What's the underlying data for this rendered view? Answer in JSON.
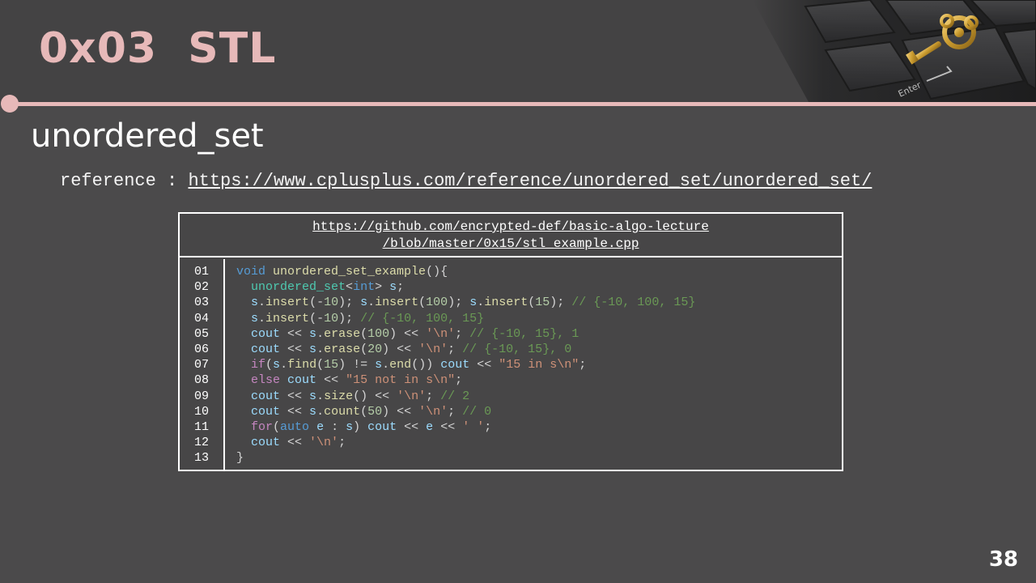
{
  "slide": {
    "title": "0x03  STL",
    "section_heading": "unordered_set",
    "reference_label": "reference : ",
    "reference_url": "https://www.cplusplus.com/reference/unordered_set/unordered_set/",
    "page_number": "38"
  },
  "code_box": {
    "header_line1": "https://github.com/encrypted-def/basic-algo-lecture",
    "header_line2": "/blob/master/0x15/stl_example.cpp",
    "line_numbers": [
      "01",
      "02",
      "03",
      "04",
      "05",
      "06",
      "07",
      "08",
      "09",
      "10",
      "11",
      "12",
      "13"
    ],
    "lines": [
      [
        [
          "kw",
          "void"
        ],
        [
          "plain",
          " "
        ],
        [
          "fn",
          "unordered_set_example"
        ],
        [
          "plain",
          "(){"
        ]
      ],
      [
        [
          "plain",
          "  "
        ],
        [
          "type",
          "unordered_set"
        ],
        [
          "plain",
          "<"
        ],
        [
          "kw",
          "int"
        ],
        [
          "plain",
          "> "
        ],
        [
          "var",
          "s"
        ],
        [
          "plain",
          ";"
        ]
      ],
      [
        [
          "plain",
          "  "
        ],
        [
          "var",
          "s"
        ],
        [
          "plain",
          "."
        ],
        [
          "fn",
          "insert"
        ],
        [
          "plain",
          "(-"
        ],
        [
          "num",
          "10"
        ],
        [
          "plain",
          "); "
        ],
        [
          "var",
          "s"
        ],
        [
          "plain",
          "."
        ],
        [
          "fn",
          "insert"
        ],
        [
          "plain",
          "("
        ],
        [
          "num",
          "100"
        ],
        [
          "plain",
          "); "
        ],
        [
          "var",
          "s"
        ],
        [
          "plain",
          "."
        ],
        [
          "fn",
          "insert"
        ],
        [
          "plain",
          "("
        ],
        [
          "num",
          "15"
        ],
        [
          "plain",
          "); "
        ],
        [
          "cmt",
          "// {-10, 100, 15}"
        ]
      ],
      [
        [
          "plain",
          "  "
        ],
        [
          "var",
          "s"
        ],
        [
          "plain",
          "."
        ],
        [
          "fn",
          "insert"
        ],
        [
          "plain",
          "(-"
        ],
        [
          "num",
          "10"
        ],
        [
          "plain",
          "); "
        ],
        [
          "cmt",
          "// {-10, 100, 15}"
        ]
      ],
      [
        [
          "plain",
          "  "
        ],
        [
          "var",
          "cout"
        ],
        [
          "plain",
          " << "
        ],
        [
          "var",
          "s"
        ],
        [
          "plain",
          "."
        ],
        [
          "fn",
          "erase"
        ],
        [
          "plain",
          "("
        ],
        [
          "num",
          "100"
        ],
        [
          "plain",
          ") << "
        ],
        [
          "str",
          "'\\n'"
        ],
        [
          "plain",
          "; "
        ],
        [
          "cmt",
          "// {-10, 15}, 1"
        ]
      ],
      [
        [
          "plain",
          "  "
        ],
        [
          "var",
          "cout"
        ],
        [
          "plain",
          " << "
        ],
        [
          "var",
          "s"
        ],
        [
          "plain",
          "."
        ],
        [
          "fn",
          "erase"
        ],
        [
          "plain",
          "("
        ],
        [
          "num",
          "20"
        ],
        [
          "plain",
          ") << "
        ],
        [
          "str",
          "'\\n'"
        ],
        [
          "plain",
          "; "
        ],
        [
          "cmt",
          "// {-10, 15}, 0"
        ]
      ],
      [
        [
          "plain",
          "  "
        ],
        [
          "ctrl",
          "if"
        ],
        [
          "plain",
          "("
        ],
        [
          "var",
          "s"
        ],
        [
          "plain",
          "."
        ],
        [
          "fn",
          "find"
        ],
        [
          "plain",
          "("
        ],
        [
          "num",
          "15"
        ],
        [
          "plain",
          ") != "
        ],
        [
          "var",
          "s"
        ],
        [
          "plain",
          "."
        ],
        [
          "fn",
          "end"
        ],
        [
          "plain",
          "()) "
        ],
        [
          "var",
          "cout"
        ],
        [
          "plain",
          " << "
        ],
        [
          "str",
          "\"15 in s\\n\""
        ],
        [
          "plain",
          ";"
        ]
      ],
      [
        [
          "plain",
          "  "
        ],
        [
          "ctrl",
          "else"
        ],
        [
          "plain",
          " "
        ],
        [
          "var",
          "cout"
        ],
        [
          "plain",
          " << "
        ],
        [
          "str",
          "\"15 not in s\\n\""
        ],
        [
          "plain",
          ";"
        ]
      ],
      [
        [
          "plain",
          "  "
        ],
        [
          "var",
          "cout"
        ],
        [
          "plain",
          " << "
        ],
        [
          "var",
          "s"
        ],
        [
          "plain",
          "."
        ],
        [
          "fn",
          "size"
        ],
        [
          "plain",
          "() << "
        ],
        [
          "str",
          "'\\n'"
        ],
        [
          "plain",
          "; "
        ],
        [
          "cmt",
          "// 2"
        ]
      ],
      [
        [
          "plain",
          "  "
        ],
        [
          "var",
          "cout"
        ],
        [
          "plain",
          " << "
        ],
        [
          "var",
          "s"
        ],
        [
          "plain",
          "."
        ],
        [
          "fn",
          "count"
        ],
        [
          "plain",
          "("
        ],
        [
          "num",
          "50"
        ],
        [
          "plain",
          ") << "
        ],
        [
          "str",
          "'\\n'"
        ],
        [
          "plain",
          "; "
        ],
        [
          "cmt",
          "// 0"
        ]
      ],
      [
        [
          "plain",
          "  "
        ],
        [
          "ctrl",
          "for"
        ],
        [
          "plain",
          "("
        ],
        [
          "kw",
          "auto"
        ],
        [
          "plain",
          " "
        ],
        [
          "var",
          "e"
        ],
        [
          "plain",
          " : "
        ],
        [
          "var",
          "s"
        ],
        [
          "plain",
          ") "
        ],
        [
          "var",
          "cout"
        ],
        [
          "plain",
          " << "
        ],
        [
          "var",
          "e"
        ],
        [
          "plain",
          " << "
        ],
        [
          "str",
          "' '"
        ],
        [
          "plain",
          ";"
        ]
      ],
      [
        [
          "plain",
          "  "
        ],
        [
          "var",
          "cout"
        ],
        [
          "plain",
          " << "
        ],
        [
          "str",
          "'\\n'"
        ],
        [
          "plain",
          ";"
        ]
      ],
      [
        [
          "plain",
          "}"
        ]
      ]
    ]
  },
  "colors": {
    "background": "#4b4a4b",
    "accent": "#e7b9b9"
  }
}
